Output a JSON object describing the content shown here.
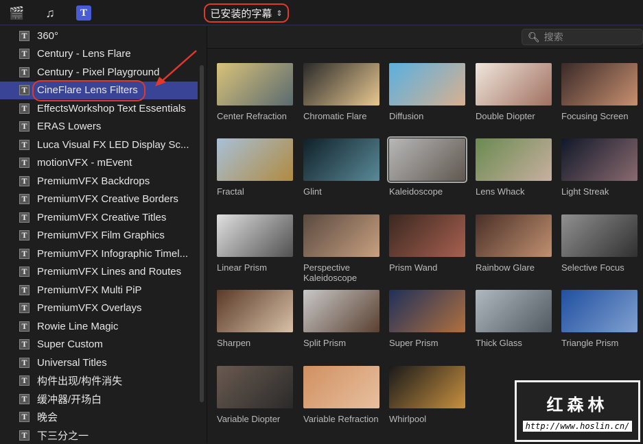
{
  "toolbar": {
    "icons": [
      "clapper-icon",
      "music-icon",
      "titles-icon"
    ],
    "dropdown_label": "已安装的字幕",
    "dropdown_chevron": "⌃⌄"
  },
  "search": {
    "placeholder": "搜索"
  },
  "sidebar": {
    "selected": "CineFlare Lens Filters",
    "items": [
      "360°",
      "Century - Lens Flare",
      "Century - Pixel Playground",
      "CineFlare Lens Filters",
      "EffectsWorkshop Text Essentials",
      "ERAS Lowers",
      "Luca Visual FX LED Display Sc...",
      "motionVFX - mEvent",
      "PremiumVFX Backdrops",
      "PremiumVFX Creative Borders",
      "PremiumVFX Creative Titles",
      "PremiumVFX Film Graphics",
      "PremiumVFX Infographic Timel...",
      "PremiumVFX Lines and Routes",
      "PremiumVFX Multi PiP",
      "PremiumVFX Overlays",
      "Rowie Line Magic",
      "Super Custom",
      "Universal Titles",
      "构件出现/构件消失",
      "缓冲器/开场白",
      "晚会",
      "下三分之一"
    ]
  },
  "browser": {
    "selected": "Kaleidoscope",
    "items": [
      {
        "label": "Center Refraction",
        "colors": [
          "#d9c27a",
          "#5a6a70"
        ]
      },
      {
        "label": "Chromatic Flare",
        "colors": [
          "#2a2a2a",
          "#e8c890"
        ]
      },
      {
        "label": "Diffusion",
        "colors": [
          "#5ab0e0",
          "#d8b090"
        ]
      },
      {
        "label": "Double Diopter",
        "colors": [
          "#f0e6dc",
          "#a07060"
        ]
      },
      {
        "label": "Focusing Screen",
        "colors": [
          "#3a2a28",
          "#c89070"
        ]
      },
      {
        "label": "Fractal",
        "colors": [
          "#a8c0d8",
          "#b08a40"
        ]
      },
      {
        "label": "Glint",
        "colors": [
          "#102028",
          "#5a8a98"
        ]
      },
      {
        "label": "Kaleidoscope",
        "colors": [
          "#b8b8b8",
          "#605850"
        ]
      },
      {
        "label": "Lens Whack",
        "colors": [
          "#6a8a50",
          "#c8b0a0"
        ]
      },
      {
        "label": "Light Streak",
        "colors": [
          "#101828",
          "#8a6a70"
        ]
      },
      {
        "label": "Linear Prism",
        "colors": [
          "#e0e0e0",
          "#505050"
        ]
      },
      {
        "label": "Perspective Kaleidoscope",
        "colors": [
          "#5a4a40",
          "#c8a080"
        ]
      },
      {
        "label": "Prism Wand",
        "colors": [
          "#3a2820",
          "#a86050"
        ]
      },
      {
        "label": "Rainbow Glare",
        "colors": [
          "#4a3028",
          "#c09070"
        ]
      },
      {
        "label": "Selective Focus",
        "colors": [
          "#909090",
          "#303030"
        ]
      },
      {
        "label": "Sharpen",
        "colors": [
          "#5a3a28",
          "#d8c0a8"
        ]
      },
      {
        "label": "Split Prism",
        "colors": [
          "#c8c8c8",
          "#5a4030"
        ]
      },
      {
        "label": "Super Prism",
        "colors": [
          "#20305a",
          "#b07040"
        ]
      },
      {
        "label": "Thick Glass",
        "colors": [
          "#b0b8c0",
          "#505860"
        ]
      },
      {
        "label": "Triangle Prism",
        "colors": [
          "#2050a0",
          "#80a0d0"
        ]
      },
      {
        "label": "Variable Diopter",
        "colors": [
          "#6a5a50",
          "#2a2a2a"
        ]
      },
      {
        "label": "Variable Refraction",
        "colors": [
          "#d09060",
          "#e8c0a0"
        ]
      },
      {
        "label": "Whirlpool",
        "colors": [
          "#1a1a1a",
          "#c89040"
        ]
      }
    ]
  },
  "watermark": {
    "title": "红森林",
    "url": "http://www.hoslin.cn/"
  }
}
